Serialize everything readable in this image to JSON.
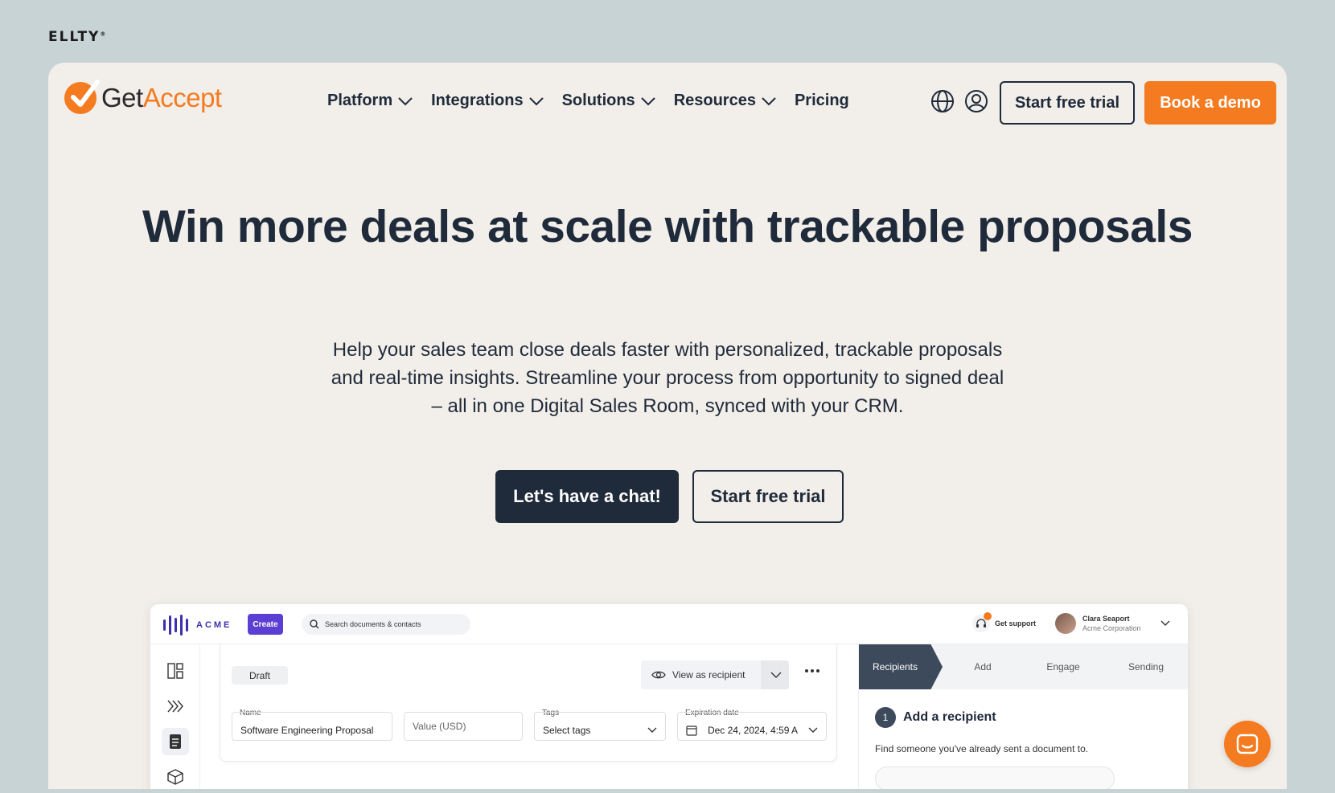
{
  "watermark": {
    "brand": "ELLTY",
    "mark": "®"
  },
  "header": {
    "logo_get": "Get",
    "logo_accept": "Accept",
    "nav": [
      {
        "label": "Platform"
      },
      {
        "label": "Integrations"
      },
      {
        "label": "Solutions"
      },
      {
        "label": "Resources"
      },
      {
        "label": "Pricing"
      }
    ],
    "start_trial": "Start free trial",
    "book_demo": "Book a demo",
    "globe_icon": "globe-icon",
    "user_icon": "user-icon"
  },
  "hero": {
    "title": "Win more deals at scale with trackable proposals",
    "subtitle": "Help your sales team close deals faster with personalized, trackable proposals and real-time insights. Streamline your process from opportunity to signed deal – all in one Digital Sales Room, synced with your CRM.",
    "chat_button": "Let's have a chat!",
    "trial_button": "Start free trial"
  },
  "app_preview": {
    "brand": "ACME",
    "create_button": "Create",
    "search_placeholder": "Search documents & contacts",
    "support_label": "Get support",
    "support_badge": "1",
    "user_name": "Clara Seaport",
    "user_company": "Acme Corporation",
    "status_badge": "Draft",
    "view_as_recipient": "View as recipient",
    "fields": {
      "name_label": "Name",
      "name_value": "Software Engineering Proposal",
      "value_placeholder": "Value (USD)",
      "tags_label": "Tags",
      "tags_value": "Select tags",
      "expiration_label": "Expiration date",
      "expiration_value": "Dec 24, 2024, 4:59 A"
    },
    "steps": [
      {
        "label": "Recipients"
      },
      {
        "label": "Add"
      },
      {
        "label": "Engage"
      },
      {
        "label": "Sending"
      }
    ],
    "step_number": "1",
    "step_title": "Add a recipient",
    "step_description": "Find someone you've already sent a document to."
  },
  "colors": {
    "brand_orange": "#f47b20",
    "navy": "#1f2a3a",
    "page_bg": "#f2eee9",
    "acme_purple": "#5b3fd3"
  }
}
